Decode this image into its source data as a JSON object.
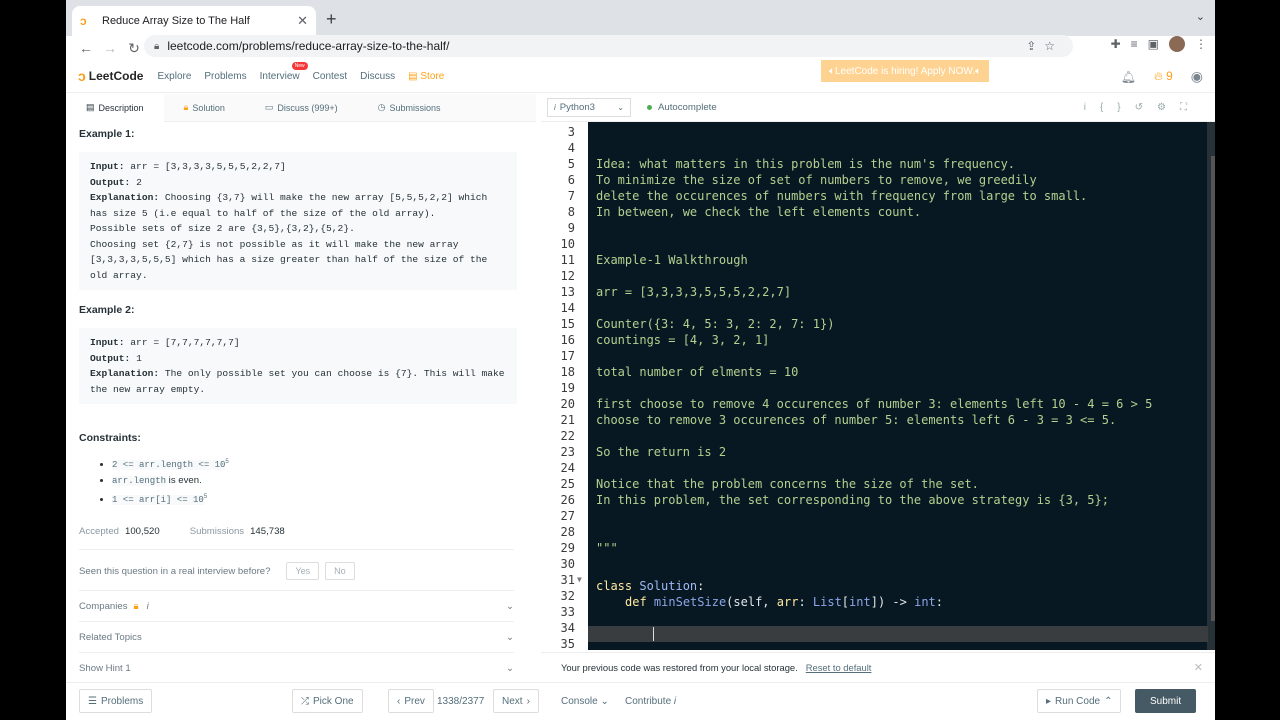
{
  "browser": {
    "tab_title": "Reduce Array Size to The Half",
    "url": "leetcode.com/problems/reduce-array-size-to-the-half/"
  },
  "nav": {
    "brand": "LeetCode",
    "items": [
      "Explore",
      "Problems",
      "Interview",
      "Contest",
      "Discuss"
    ],
    "new_badge": "New",
    "store": "Store",
    "hiring": "LeetCode is hiring! Apply NOW.",
    "streak": "9"
  },
  "left_tabs": [
    "Description",
    "Solution",
    "Discuss (999+)",
    "Submissions"
  ],
  "examples": [
    {
      "title": "Example 1:",
      "lines": [
        {
          "label": "Input:",
          "text": " arr = [3,3,3,3,5,5,5,2,2,7]"
        },
        {
          "label": "Output:",
          "text": " 2"
        },
        {
          "label": "Explanation:",
          "text": " Choosing {3,7} will make the new array [5,5,5,2,2] which has size 5 (i.e equal to half of the size of the old array).\nPossible sets of size 2 are {3,5},{3,2},{5,2}.\nChoosing set {2,7} is not possible as it will make the new array [3,3,3,3,5,5,5] which has a size greater than half of the size of the old array."
        }
      ]
    },
    {
      "title": "Example 2:",
      "lines": [
        {
          "label": "Input:",
          "text": " arr = [7,7,7,7,7,7]"
        },
        {
          "label": "Output:",
          "text": " 1"
        },
        {
          "label": "Explanation:",
          "text": " The only possible set you can choose is {7}. This will make the new array empty."
        }
      ]
    }
  ],
  "constraints": {
    "title": "Constraints:",
    "items": [
      {
        "code": "2 <= arr.length <= 10",
        "sup": "5",
        "rest": ""
      },
      {
        "code": "arr.length",
        "sup": "",
        "rest": " is even."
      },
      {
        "code": "1 <= arr[i] <= 10",
        "sup": "5",
        "rest": ""
      }
    ]
  },
  "stats": {
    "accepted_label": "Accepted",
    "accepted": "100,520",
    "submissions_label": "Submissions",
    "submissions": "145,738"
  },
  "seen": {
    "question": "Seen this question in a real interview before?",
    "yes": "Yes",
    "no": "No"
  },
  "accordions": [
    "Companies",
    "Related Topics",
    "Show Hint 1"
  ],
  "editor": {
    "language": "Python3",
    "autocomplete": "Autocomplete",
    "lines": [
      {
        "n": "3",
        "t": ""
      },
      {
        "n": "4",
        "t": ""
      },
      {
        "n": "5",
        "t": "Idea: what matters in this problem is the num's frequency."
      },
      {
        "n": "6",
        "t": "To minimize the size of set of numbers to remove, we greedily"
      },
      {
        "n": "7",
        "t": "delete the occurences of numbers with frequency from large to small."
      },
      {
        "n": "8",
        "t": "In between, we check the left elements count."
      },
      {
        "n": "9",
        "t": ""
      },
      {
        "n": "10",
        "t": ""
      },
      {
        "n": "11",
        "t": "Example-1 Walkthrough"
      },
      {
        "n": "12",
        "t": ""
      },
      {
        "n": "13",
        "t": "arr = [3,3,3,3,5,5,5,2,2,7]"
      },
      {
        "n": "14",
        "t": ""
      },
      {
        "n": "15",
        "t": "Counter({3: 4, 5: 3, 2: 2, 7: 1})"
      },
      {
        "n": "16",
        "t": "countings = [4, 3, 2, 1]"
      },
      {
        "n": "17",
        "t": ""
      },
      {
        "n": "18",
        "t": "total number of elments = 10"
      },
      {
        "n": "19",
        "t": ""
      },
      {
        "n": "20",
        "t": "first choose to remove 4 occurences of number 3: elements left 10 - 4 = 6 > 5"
      },
      {
        "n": "21",
        "t": "choose to remove 3 occurences of number 5: elements left 6 - 3 = 3 <= 5."
      },
      {
        "n": "22",
        "t": ""
      },
      {
        "n": "23",
        "t": "So the return is 2"
      },
      {
        "n": "24",
        "t": ""
      },
      {
        "n": "25",
        "t": "Notice that the problem concerns the size of the set."
      },
      {
        "n": "26",
        "t": "In this problem, the set corresponding to the above strategy is {3, 5};"
      },
      {
        "n": "27",
        "t": ""
      },
      {
        "n": "28",
        "t": ""
      },
      {
        "n": "29",
        "t": "\"\"\""
      },
      {
        "n": "30",
        "t": ""
      },
      {
        "n": "31",
        "t": ""
      },
      {
        "n": "32",
        "t": ""
      },
      {
        "n": "33",
        "t": ""
      },
      {
        "n": "34",
        "t": ""
      },
      {
        "n": "35",
        "t": ""
      }
    ],
    "class_kw": "class",
    "class_name": "Solution",
    "def_kw": "def",
    "func": "minSetSize",
    "params": "(self, ",
    "arr_name": "arr",
    "list_type": "List",
    "int_type": "int",
    "ret": "-> ",
    "ret_type": "int"
  },
  "restore_msg": "Your previous code was restored from your local storage.",
  "reset_link": "Reset to default",
  "bottom": {
    "problems": "Problems",
    "pick_one": "Pick One",
    "prev": "Prev",
    "counter": "1338/2377",
    "next": "Next",
    "console": "Console",
    "contribute": "Contribute",
    "run": "Run Code",
    "submit": "Submit"
  }
}
